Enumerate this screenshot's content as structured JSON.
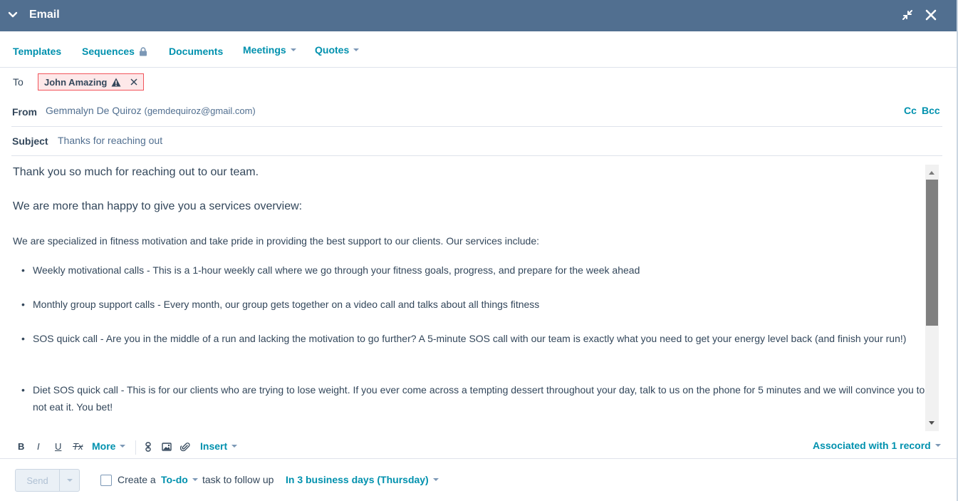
{
  "header": {
    "title": "Email"
  },
  "toolbar": {
    "templates": "Templates",
    "sequences": "Sequences",
    "documents": "Documents",
    "meetings": "Meetings",
    "quotes": "Quotes"
  },
  "fields": {
    "to_label": "To",
    "to_recipient": "John Amazing",
    "from_label": "From",
    "from_name": "Gemmalyn De Quiroz",
    "from_email": "(gemdequiroz@gmail.com)",
    "cc": "Cc",
    "bcc": "Bcc",
    "subject_label": "Subject",
    "subject_value": "Thanks for reaching out"
  },
  "body": {
    "p1": "Thank you so much for reaching out to our team.",
    "p2": "We are more than happy to give you a services overview:",
    "p3": "We are specialized in fitness motivation and take pride in providing the best support to our clients. Our services include:",
    "bullets": [
      "Weekly motivational calls - This is a 1-hour weekly call where we go through your fitness goals, progress, and prepare for the week ahead",
      "Monthly group support calls - Every month, our group gets together on a video call and talks about all things fitness",
      "SOS quick call - Are you in the middle of a run and lacking the motivation to go further? A 5-minute SOS call with our team is exactly what you need to get your energy level back (and finish your run!)",
      "Diet SOS quick call - This is for our clients who are trying to lose weight. If you ever come across a tempting dessert throughout your day, talk to us on the phone for 5 minutes and we will convince you to not eat it. You bet!"
    ]
  },
  "format_bar": {
    "bold": "B",
    "italic": "I",
    "underline": "U",
    "clear": "Tx",
    "more": "More",
    "insert": "Insert",
    "associated": "Associated with 1 record"
  },
  "footer": {
    "send": "Send",
    "create_a": "Create a",
    "todo": "To-do",
    "task_text": "task to follow up",
    "due": "In 3 business days (Thursday)"
  },
  "colors": {
    "header_bg": "#516f90",
    "link": "#0091ae",
    "chip_border": "#f2545b",
    "chip_bg": "#fde8e9"
  }
}
